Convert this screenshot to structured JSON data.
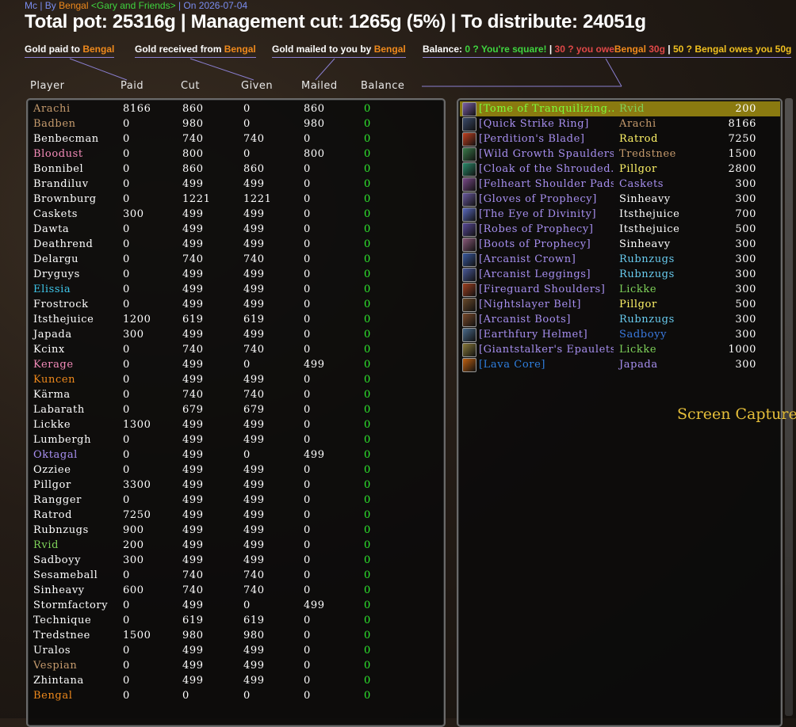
{
  "header": {
    "source": "Mc",
    "by_label": "By",
    "author": "Bengal",
    "guild": "<Gary and Friends>",
    "on_label": "On",
    "date": "2026-07-04",
    "title": "Total pot: 25316g | Management cut: 1265g (5%) | To distribute: 24051g"
  },
  "legend": {
    "paid_prefix": "Gold paid to",
    "received_prefix": "Gold received from",
    "mailed_prefix": "Gold mailed to you by",
    "player": "Bengal",
    "balance_label": "Balance:",
    "square": "0 ? You're square!",
    "sep": "|",
    "owe": "30 ? you owe",
    "owe_amount": "30g",
    "owes": "50 ? Bengal owes you 50g"
  },
  "columns": {
    "player": "Player",
    "paid": "Paid",
    "cut": "Cut",
    "given": "Given",
    "mailed": "Mailed",
    "balance": "Balance"
  },
  "colors": {
    "orange": "#f08a1c",
    "tan": "#c69b6d",
    "white": "#ffffff",
    "pink": "#f58cba",
    "cyan": "#3fc7eb",
    "purple": "#a78ff0",
    "green": "#2ee82e",
    "yellow": "#fff468",
    "epic": "#a335ee",
    "rare": "#2f7fe0",
    "legendary": "#7cff3a",
    "lightblue": "#69ccf0"
  },
  "players": [
    {
      "name": "Arachi",
      "color": "#c69b6d",
      "paid": "8166",
      "cut": "860",
      "given": "0",
      "mailed": "860",
      "balance": "0"
    },
    {
      "name": "Badben",
      "color": "#c69b6d",
      "paid": "0",
      "cut": "980",
      "given": "0",
      "mailed": "980",
      "balance": "0"
    },
    {
      "name": "Benbecman",
      "color": "#ffffff",
      "paid": "0",
      "cut": "740",
      "given": "740",
      "mailed": "0",
      "balance": "0"
    },
    {
      "name": "Bloodust",
      "color": "#f58cba",
      "paid": "0",
      "cut": "800",
      "given": "0",
      "mailed": "800",
      "balance": "0"
    },
    {
      "name": "Bonnibel",
      "color": "#ffffff",
      "paid": "0",
      "cut": "860",
      "given": "860",
      "mailed": "0",
      "balance": "0"
    },
    {
      "name": "Brandiluv",
      "color": "#ffffff",
      "paid": "0",
      "cut": "499",
      "given": "499",
      "mailed": "0",
      "balance": "0"
    },
    {
      "name": "Brownburg",
      "color": "#ffffff",
      "paid": "0",
      "cut": "1221",
      "given": "1221",
      "mailed": "0",
      "balance": "0"
    },
    {
      "name": "Caskets",
      "color": "#ffffff",
      "paid": "300",
      "cut": "499",
      "given": "499",
      "mailed": "0",
      "balance": "0"
    },
    {
      "name": "Dawta",
      "color": "#ffffff",
      "paid": "0",
      "cut": "499",
      "given": "499",
      "mailed": "0",
      "balance": "0"
    },
    {
      "name": "Deathrend",
      "color": "#ffffff",
      "paid": "0",
      "cut": "499",
      "given": "499",
      "mailed": "0",
      "balance": "0"
    },
    {
      "name": "Delargu",
      "color": "#ffffff",
      "paid": "0",
      "cut": "740",
      "given": "740",
      "mailed": "0",
      "balance": "0"
    },
    {
      "name": "Dryguys",
      "color": "#ffffff",
      "paid": "0",
      "cut": "499",
      "given": "499",
      "mailed": "0",
      "balance": "0"
    },
    {
      "name": "Elissia",
      "color": "#3fc7eb",
      "paid": "0",
      "cut": "499",
      "given": "499",
      "mailed": "0",
      "balance": "0"
    },
    {
      "name": "Frostrock",
      "color": "#ffffff",
      "paid": "0",
      "cut": "499",
      "given": "499",
      "mailed": "0",
      "balance": "0"
    },
    {
      "name": "Itsthejuice",
      "color": "#ffffff",
      "paid": "1200",
      "cut": "619",
      "given": "619",
      "mailed": "0",
      "balance": "0"
    },
    {
      "name": "Japada",
      "color": "#ffffff",
      "paid": "300",
      "cut": "499",
      "given": "499",
      "mailed": "0",
      "balance": "0"
    },
    {
      "name": "Kcinx",
      "color": "#ffffff",
      "paid": "0",
      "cut": "740",
      "given": "740",
      "mailed": "0",
      "balance": "0"
    },
    {
      "name": "Kerage",
      "color": "#f58cba",
      "paid": "0",
      "cut": "499",
      "given": "0",
      "mailed": "499",
      "balance": "0"
    },
    {
      "name": "Kuncen",
      "color": "#f08a1c",
      "paid": "0",
      "cut": "499",
      "given": "499",
      "mailed": "0",
      "balance": "0"
    },
    {
      "name": "Kärma",
      "color": "#ffffff",
      "paid": "0",
      "cut": "740",
      "given": "740",
      "mailed": "0",
      "balance": "0"
    },
    {
      "name": "Labarath",
      "color": "#ffffff",
      "paid": "0",
      "cut": "679",
      "given": "679",
      "mailed": "0",
      "balance": "0"
    },
    {
      "name": "Lickke",
      "color": "#ffffff",
      "paid": "1300",
      "cut": "499",
      "given": "499",
      "mailed": "0",
      "balance": "0"
    },
    {
      "name": "Lumbergh",
      "color": "#ffffff",
      "paid": "0",
      "cut": "499",
      "given": "499",
      "mailed": "0",
      "balance": "0"
    },
    {
      "name": "Oktagal",
      "color": "#a78ff0",
      "paid": "0",
      "cut": "499",
      "given": "0",
      "mailed": "499",
      "balance": "0"
    },
    {
      "name": "Ozziee",
      "color": "#ffffff",
      "paid": "0",
      "cut": "499",
      "given": "499",
      "mailed": "0",
      "balance": "0"
    },
    {
      "name": "Pillgor",
      "color": "#ffffff",
      "paid": "3300",
      "cut": "499",
      "given": "499",
      "mailed": "0",
      "balance": "0"
    },
    {
      "name": "Rangger",
      "color": "#ffffff",
      "paid": "0",
      "cut": "499",
      "given": "499",
      "mailed": "0",
      "balance": "0"
    },
    {
      "name": "Ratrod",
      "color": "#ffffff",
      "paid": "7250",
      "cut": "499",
      "given": "499",
      "mailed": "0",
      "balance": "0"
    },
    {
      "name": "Rubnzugs",
      "color": "#ffffff",
      "paid": "900",
      "cut": "499",
      "given": "499",
      "mailed": "0",
      "balance": "0"
    },
    {
      "name": "Rvid",
      "color": "#7fd35a",
      "paid": "200",
      "cut": "499",
      "given": "499",
      "mailed": "0",
      "balance": "0"
    },
    {
      "name": "Sadboyy",
      "color": "#ffffff",
      "paid": "300",
      "cut": "499",
      "given": "499",
      "mailed": "0",
      "balance": "0"
    },
    {
      "name": "Sesameball",
      "color": "#ffffff",
      "paid": "0",
      "cut": "740",
      "given": "740",
      "mailed": "0",
      "balance": "0"
    },
    {
      "name": "Sinheavy",
      "color": "#ffffff",
      "paid": "600",
      "cut": "740",
      "given": "740",
      "mailed": "0",
      "balance": "0"
    },
    {
      "name": "Stormfactory",
      "color": "#ffffff",
      "paid": "0",
      "cut": "499",
      "given": "0",
      "mailed": "499",
      "balance": "0"
    },
    {
      "name": "Technique",
      "color": "#ffffff",
      "paid": "0",
      "cut": "619",
      "given": "619",
      "mailed": "0",
      "balance": "0"
    },
    {
      "name": "Tredstnee",
      "color": "#ffffff",
      "paid": "1500",
      "cut": "980",
      "given": "980",
      "mailed": "0",
      "balance": "0"
    },
    {
      "name": "Uralos",
      "color": "#ffffff",
      "paid": "0",
      "cut": "499",
      "given": "499",
      "mailed": "0",
      "balance": "0"
    },
    {
      "name": "Vespian",
      "color": "#c69b6d",
      "paid": "0",
      "cut": "499",
      "given": "499",
      "mailed": "0",
      "balance": "0"
    },
    {
      "name": "Zhintana",
      "color": "#ffffff",
      "paid": "0",
      "cut": "499",
      "given": "499",
      "mailed": "0",
      "balance": "0"
    },
    {
      "name": "Bengal",
      "color": "#f08a1c",
      "paid": "0",
      "cut": "0",
      "given": "0",
      "mailed": "0",
      "balance": "0"
    }
  ],
  "items": [
    {
      "name": "[Tome of Tranquilizing...",
      "item_color": "#7cff3a",
      "winner": "Rvid",
      "winner_color": "#7fd35a",
      "value": "200",
      "selected": true,
      "icon": "tome-icon",
      "icon_color": "#7b5fa8"
    },
    {
      "name": "[Quick Strike Ring]",
      "item_color": "#a78ff0",
      "winner": "Arachi",
      "winner_color": "#c69b6d",
      "value": "8166",
      "selected": false,
      "icon": "ring-icon",
      "icon_color": "#3a4a6a"
    },
    {
      "name": "[Perdition's Blade]",
      "item_color": "#a78ff0",
      "winner": "Ratrod",
      "winner_color": "#fff468",
      "value": "7250",
      "selected": false,
      "icon": "dagger-icon",
      "icon_color": "#c04020"
    },
    {
      "name": "[Wild Growth Spaulders]",
      "item_color": "#a78ff0",
      "winner": "Tredstnee",
      "winner_color": "#c69b6d",
      "value": "1500",
      "selected": false,
      "icon": "shoulder-icon",
      "icon_color": "#3a7a4a"
    },
    {
      "name": "[Cloak of the Shrouded...",
      "item_color": "#a78ff0",
      "winner": "Pillgor",
      "winner_color": "#fff468",
      "value": "2800",
      "selected": false,
      "icon": "cloak-icon",
      "icon_color": "#2a8a6a"
    },
    {
      "name": "[Felheart Shoulder Pads]",
      "item_color": "#a78ff0",
      "winner": "Caskets",
      "winner_color": "#a78ff0",
      "value": "300",
      "selected": false,
      "icon": "shoulder-icon",
      "icon_color": "#7a4a8a"
    },
    {
      "name": "[Gloves of Prophecy]",
      "item_color": "#a78ff0",
      "winner": "Sinheavy",
      "winner_color": "#ffffff",
      "value": "300",
      "selected": false,
      "icon": "gloves-icon",
      "icon_color": "#6a5aa0"
    },
    {
      "name": "[The Eye of Divinity]",
      "item_color": "#a78ff0",
      "winner": "Itsthejuice",
      "winner_color": "#ffffff",
      "value": "700",
      "selected": false,
      "icon": "orb-icon",
      "icon_color": "#5a6ac0"
    },
    {
      "name": "[Robes of Prophecy]",
      "item_color": "#a78ff0",
      "winner": "Itsthejuice",
      "winner_color": "#ffffff",
      "value": "500",
      "selected": false,
      "icon": "robe-icon",
      "icon_color": "#5a4a9a"
    },
    {
      "name": "[Boots of Prophecy]",
      "item_color": "#a78ff0",
      "winner": "Sinheavy",
      "winner_color": "#ffffff",
      "value": "300",
      "selected": false,
      "icon": "boots-icon",
      "icon_color": "#8a5a7a"
    },
    {
      "name": "[Arcanist Crown]",
      "item_color": "#a78ff0",
      "winner": "Rubnzugs",
      "winner_color": "#69ccf0",
      "value": "300",
      "selected": false,
      "icon": "helm-icon",
      "icon_color": "#3a5aa0"
    },
    {
      "name": "[Arcanist Leggings]",
      "item_color": "#a78ff0",
      "winner": "Rubnzugs",
      "winner_color": "#69ccf0",
      "value": "300",
      "selected": false,
      "icon": "legs-icon",
      "icon_color": "#4a5a9a"
    },
    {
      "name": "[Fireguard Shoulders]",
      "item_color": "#a78ff0",
      "winner": "Lickke",
      "winner_color": "#7fd35a",
      "value": "300",
      "selected": false,
      "icon": "shoulder-icon",
      "icon_color": "#a04020"
    },
    {
      "name": "[Nightslayer Belt]",
      "item_color": "#a78ff0",
      "winner": "Pillgor",
      "winner_color": "#fff468",
      "value": "500",
      "selected": false,
      "icon": "belt-icon",
      "icon_color": "#6a4a2a"
    },
    {
      "name": "[Arcanist Boots]",
      "item_color": "#a78ff0",
      "winner": "Rubnzugs",
      "winner_color": "#69ccf0",
      "value": "300",
      "selected": false,
      "icon": "boots-icon",
      "icon_color": "#7a4a2a"
    },
    {
      "name": "[Earthfury Helmet]",
      "item_color": "#a78ff0",
      "winner": "Sadboyy",
      "winner_color": "#3a7ae0",
      "value": "300",
      "selected": false,
      "icon": "helm-icon",
      "icon_color": "#4a6a8a"
    },
    {
      "name": "[Giantstalker's Epaulets]",
      "item_color": "#a78ff0",
      "winner": "Lickke",
      "winner_color": "#7fd35a",
      "value": "1000",
      "selected": false,
      "icon": "shoulder-icon",
      "icon_color": "#8a7a3a"
    },
    {
      "name": "[Lava Core]",
      "item_color": "#2f7fe0",
      "winner": "Japada",
      "winner_color": "#a78ff0",
      "value": "300",
      "selected": false,
      "icon": "core-icon",
      "icon_color": "#c06010"
    }
  ],
  "overlay": {
    "caption": "Screen Capture"
  }
}
